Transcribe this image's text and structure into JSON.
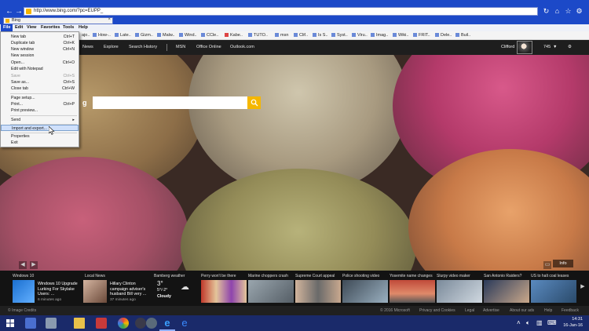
{
  "browser": {
    "address_url": "http://www.bing.com/?pc=EUPP_",
    "tab_title": "Bing"
  },
  "menubar": {
    "items": [
      "File",
      "Edit",
      "View",
      "Favorites",
      "Tools",
      "Help"
    ]
  },
  "favorites": [
    "ajo..",
    "How-..",
    "Late..",
    "Gizm..",
    "Malw..",
    "Wind..",
    "CCle..",
    "Kabe..",
    "TUTO..",
    "msn",
    "Clif..",
    "Is S..",
    "Syst..",
    "Viru..",
    "Imag..",
    "Wiki..",
    "FRIT..",
    "Dele..",
    "Buil.."
  ],
  "file_menu": {
    "items": [
      {
        "label": "New tab",
        "shortcut": "Ctrl+T"
      },
      {
        "label": "Duplicate tab",
        "shortcut": "Ctrl+K"
      },
      {
        "label": "New window",
        "shortcut": "Ctrl+N"
      },
      {
        "label": "New session",
        "shortcut": ""
      },
      {
        "label": "Open...",
        "shortcut": "Ctrl+O"
      },
      {
        "label": "Edit with Notepad",
        "shortcut": ""
      },
      {
        "label": "Save",
        "shortcut": "Ctrl+S"
      },
      {
        "label": "Save as...",
        "shortcut": "Ctrl+S"
      },
      {
        "label": "Close tab",
        "shortcut": "Ctrl+W"
      },
      {
        "label": "Page setup...",
        "shortcut": ""
      },
      {
        "label": "Print...",
        "shortcut": "Ctrl+P"
      },
      {
        "label": "Print preview...",
        "shortcut": ""
      },
      {
        "label": "Send",
        "shortcut": "▸"
      },
      {
        "label": "Import and export...",
        "shortcut": ""
      },
      {
        "label": "Properties",
        "shortcut": ""
      },
      {
        "label": "Exit",
        "shortcut": ""
      }
    ]
  },
  "bing_nav": {
    "items": [
      "News",
      "Explore",
      "Search History",
      "MSN",
      "Office Online",
      "Outlook.com"
    ],
    "user": "Clifford",
    "points": "745"
  },
  "hero": {
    "logo_fragment": "g",
    "info_label": "Info"
  },
  "news": [
    {
      "category": "Windows 10",
      "headline": "Windows 10 Upgrade\nLurking For Skylake\nUsers: ...",
      "time": "6 minutes ago"
    },
    {
      "category": "Local News",
      "headline": "Hillary Clinton\ncampaign adviser's\nhusband Bill very ...",
      "time": "37 minutes ago"
    },
    {
      "category": "Bamberg weather",
      "headline": "",
      "time": ""
    },
    {
      "category": "Perry won't be there",
      "headline": "",
      "time": ""
    },
    {
      "category": "Marine choppers crash",
      "headline": "",
      "time": ""
    },
    {
      "category": "Supreme Court appeal",
      "headline": "",
      "time": ""
    },
    {
      "category": "Police shooting video",
      "headline": "",
      "time": ""
    },
    {
      "category": "Yosemite name changes",
      "headline": "",
      "time": ""
    },
    {
      "category": "Slurpy video maker",
      "headline": "",
      "time": ""
    },
    {
      "category": "San Antonio Raiders?",
      "headline": "",
      "time": ""
    },
    {
      "category": "US to halt coal leases",
      "headline": "",
      "time": ""
    }
  ],
  "weather": {
    "temp": "3°",
    "range": "5°/-2°",
    "condition": "Cloudy"
  },
  "footer": {
    "left": "© Image Credits",
    "links": [
      "© 2016 Microsoft",
      "Privacy and Cookies",
      "Legal",
      "Advertise",
      "About our ads",
      "Help",
      "Feedback"
    ]
  },
  "taskbar": {
    "time": "14:31",
    "date": "16-Jan-16"
  }
}
